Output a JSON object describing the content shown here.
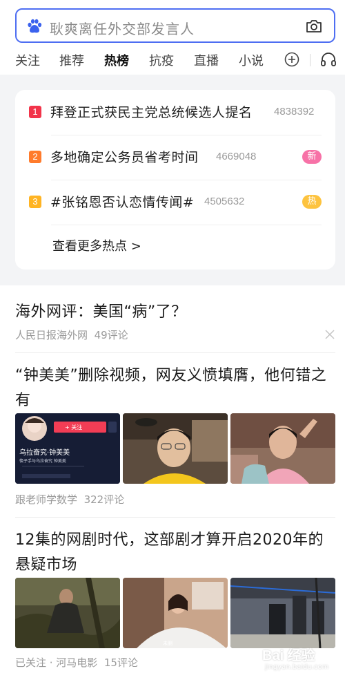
{
  "search": {
    "query": "耿爽离任外交部发言人"
  },
  "tabs": [
    "关注",
    "推荐",
    "热榜",
    "抗疫",
    "直播",
    "小说"
  ],
  "active_tab": "热榜",
  "hot_list": [
    {
      "rank": "1",
      "title": "拜登正式获民主党总统候选人提名",
      "count": "4838392",
      "tag": "",
      "rank_color": "#f2344a"
    },
    {
      "rank": "2",
      "title": "多地确定公务员省考时间",
      "count": "4669048",
      "tag": "新",
      "rank_color": "#ff7b2c",
      "tag_color": "#f772a7"
    },
    {
      "rank": "3",
      "title": "#张铭恩否认恋情传闻#",
      "count": "4505632",
      "tag": "热",
      "rank_color": "#ffb423",
      "tag_color": "#fdc33f"
    }
  ],
  "more_link": "查看更多热点 >",
  "news": [
    {
      "headline": "海外网评：美国“病”了？",
      "source": "人民日报海外网",
      "comments": "49评论"
    },
    {
      "headline": "“钟美美”删除视频，网友义愤填膺，他何错之有",
      "source": "跟老师学数学",
      "comments": "322评论",
      "thumb_overlay": {
        "follow_button": "+ 关注",
        "name": "乌拉奋究·钟美美",
        "caption": "筷子手与乌拉奋究 钟美美"
      }
    },
    {
      "headline": "12集的网剧时代，这部剧才算开启2020年的悬疑市场",
      "source": "已关注 · 河马电影",
      "comments": "15评论",
      "thumb_overlay": {
        "mark": "未删"
      }
    }
  ],
  "watermark": {
    "text": "Bai 经验",
    "url": "jingyan.baidu.com"
  },
  "colors": {
    "accent": "#4e6ef2",
    "feed_bg": "#f3f4f6"
  }
}
